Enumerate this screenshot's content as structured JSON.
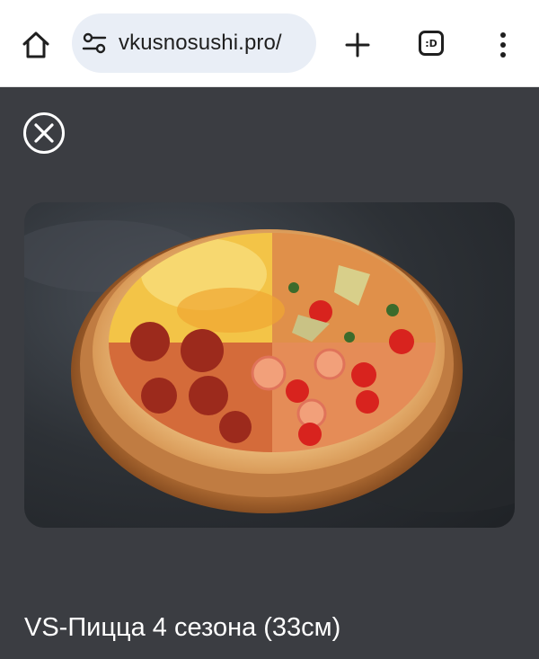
{
  "browser": {
    "url": "vkusnosushi.pro/",
    "tabs_label": ":D"
  },
  "product": {
    "title": "VS-Пицца 4 сезона (33см)"
  },
  "icons": {
    "home": "home-icon",
    "site_settings": "site-settings-icon",
    "new_tab": "plus-icon",
    "tabs": "tabs-icon",
    "menu": "more-vert-icon",
    "close": "close-circle-icon"
  },
  "colors": {
    "page_background": "#3b3d42",
    "urlbar_background": "#e9eef6",
    "text_dark": "#1f1f1f",
    "text_light": "#ffffff"
  }
}
